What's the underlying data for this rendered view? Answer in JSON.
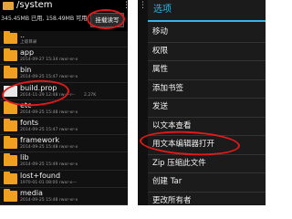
{
  "left": {
    "header": {
      "path": "/system",
      "usage": "345.45MB 已用, 158.49MB 可用, 允许读写",
      "mount_button": "挂载读写",
      "more_icon": "⋮"
    },
    "files": [
      {
        "name": "..",
        "meta": "上级目录",
        "size": "",
        "icon": "folder-icon"
      },
      {
        "name": "app",
        "meta": "2014-09-27 15:34 rwxr-xr-x",
        "size": "",
        "icon": "folder-icon"
      },
      {
        "name": "bin",
        "meta": "2014-09-25 15:47 rwxr-xr-x",
        "size": "",
        "icon": "folder-icon"
      },
      {
        "name": "build.prop",
        "meta": "2014-11-29 12:48 rw-r--r--",
        "size": "2.27K",
        "icon": "file-icon"
      },
      {
        "name": "etc",
        "meta": "2014-09-25 15:48 rwxr-xr-x",
        "size": "",
        "icon": "folder-icon"
      },
      {
        "name": "fonts",
        "meta": "2014-09-25 15:47 rwxr-xr-x",
        "size": "",
        "icon": "folder-icon"
      },
      {
        "name": "framework",
        "meta": "2014-09-25 15:48 rwxr-xr-x",
        "size": "",
        "icon": "folder-icon"
      },
      {
        "name": "lib",
        "meta": "2014-09-25 15:49 rwxr-xr-x",
        "size": "",
        "icon": "folder-icon"
      },
      {
        "name": "lost+found",
        "meta": "1970-01-01 08:00 rwxr-x---",
        "size": "",
        "icon": "folder-icon"
      },
      {
        "name": "media",
        "meta": "2014-09-25 15:48 rwxr-xr-x",
        "size": "",
        "icon": "folder-icon"
      }
    ]
  },
  "right": {
    "more_icon": "⋮",
    "title": "选项",
    "menu": [
      "移动",
      "权限",
      "属性",
      "添加书签",
      "发送",
      "以文本查看",
      "用文本编辑器打开",
      "Zip 压缩此文件",
      "创建 Tar",
      "更改所有者"
    ]
  },
  "colors": {
    "accent": "#33b5e5",
    "annotation": "#e0191b",
    "folder": "#f0a020",
    "background_dark": "#111111"
  }
}
